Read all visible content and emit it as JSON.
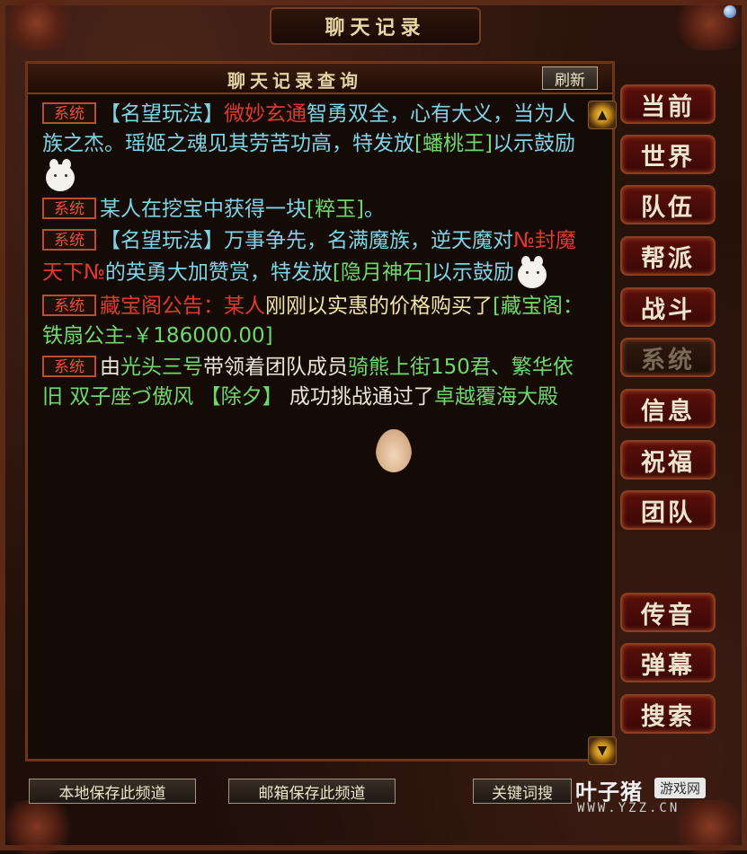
{
  "window": {
    "title": "聊天记录"
  },
  "panel": {
    "title": "聊天记录查询",
    "refresh_label": "刷新"
  },
  "messages": [
    {
      "tag": "系统",
      "parts": [
        {
          "text": "【名望玩法】",
          "color": "cyan"
        },
        {
          "text": "微妙玄通",
          "color": "red"
        },
        {
          "text": "智勇双全，心有大义，当为人族之杰。瑶姬之魂见其劳苦功高，特发放",
          "color": "cyan"
        },
        {
          "text": "[蟠桃王]",
          "color": "green"
        },
        {
          "text": "以示鼓励",
          "color": "cyan"
        }
      ],
      "emote": "bunny-emote"
    },
    {
      "tag": "系统",
      "parts": [
        {
          "text": "某人在挖宝中获得一块",
          "color": "cyan"
        },
        {
          "text": "[粹玉]",
          "color": "green"
        },
        {
          "text": "。",
          "color": "cyan"
        }
      ]
    },
    {
      "tag": "系统",
      "parts": [
        {
          "text": "【名望玩法】",
          "color": "cyan"
        },
        {
          "text": "万事争先，名满魔族，逆天魔对",
          "color": "cyan"
        },
        {
          "text": "№封魔天下№",
          "color": "red"
        },
        {
          "text": "的英勇大加赞赏，特发放",
          "color": "cyan"
        },
        {
          "text": "[隐月神石]",
          "color": "green"
        },
        {
          "text": "以示鼓励",
          "color": "cyan"
        }
      ],
      "emote": "bunny-emote"
    },
    {
      "tag": "系统",
      "parts": [
        {
          "text": "藏宝阁公告：某人",
          "color": "red"
        },
        {
          "text": "刚刚以实惠的价格购买了",
          "color": "yellow"
        },
        {
          "text": "[藏宝阁：铁扇公主-￥186000.00]",
          "color": "green"
        }
      ]
    },
    {
      "tag": "系统",
      "parts": [
        {
          "text": "由",
          "color": "white"
        },
        {
          "text": "光头三号",
          "color": "green"
        },
        {
          "text": "带领着团队成员",
          "color": "white"
        },
        {
          "text": "骑熊上街150君、繁华依旧 双子座づ傲风 【除夕】",
          "color": "green"
        },
        {
          "text": " 成功挑战通过了",
          "color": "white"
        },
        {
          "text": "卓越覆海大殿",
          "color": "green"
        }
      ]
    }
  ],
  "tabs": [
    "当前",
    "世界",
    "队伍",
    "帮派",
    "战斗",
    "系统",
    "信息",
    "祝福",
    "团队",
    "传音",
    "弹幕",
    "搜索"
  ],
  "active_tab": "系统",
  "bottom": {
    "save_local": "本地保存此频道",
    "save_mail": "邮箱保存此频道",
    "keyword_search": "关键词搜"
  },
  "watermark": {
    "name": "叶子猪",
    "badge": "游戏网",
    "url": "WWW.YZZ.CN"
  },
  "colors": {
    "cyan": "#7ed3e6",
    "red": "#e0382f",
    "green": "#6fd86b",
    "white": "#eae6da",
    "yellow": "#f0e4a8"
  }
}
